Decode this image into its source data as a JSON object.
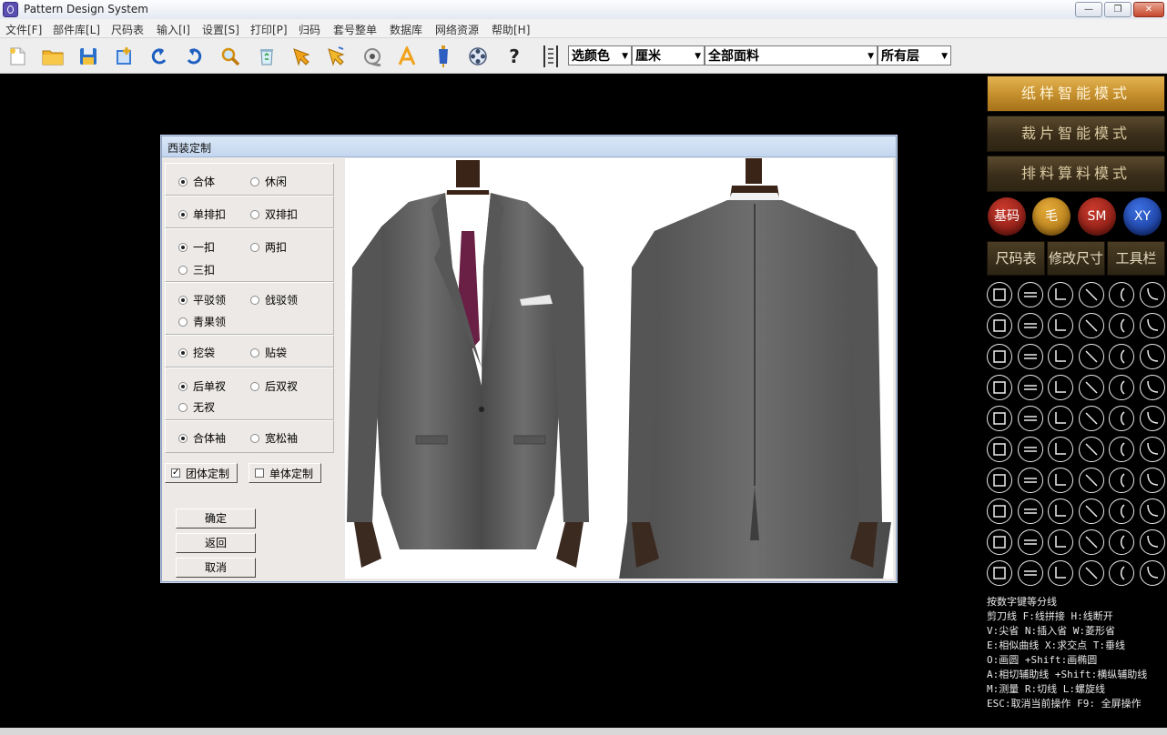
{
  "window": {
    "title": "Pattern Design System",
    "min": "—",
    "max": "❐",
    "close": "✕"
  },
  "menu": [
    "文件[F]",
    "部件库[L]",
    "尺码表",
    "输入[I]",
    "设置[S]",
    "打印[P]",
    "归码",
    "套号整单",
    "数据库",
    "网络资源",
    "帮助[H]"
  ],
  "toolbar": {
    "icons": [
      "new-file-icon",
      "open-folder-icon",
      "save-icon",
      "add-page-icon",
      "undo-icon",
      "redo-icon",
      "zoom-icon",
      "recycle-bin-icon",
      "pointer-arrow-icon",
      "select-arrow-icon",
      "tape-icon",
      "text-a-icon",
      "mannequin-icon",
      "film-reel-icon",
      "help-icon",
      "ruler-icon"
    ],
    "help_label": "?",
    "color_select": "选颜色",
    "unit_select": "厘米",
    "fabric_select": "全部面料",
    "layer_select": "所有层"
  },
  "dialog": {
    "title": "西装定制",
    "groups": [
      {
        "options": [
          {
            "label": "合体",
            "checked": true
          },
          {
            "label": "休闲",
            "checked": false
          }
        ]
      },
      {
        "options": [
          {
            "label": "单排扣",
            "checked": true
          },
          {
            "label": "双排扣",
            "checked": false
          }
        ]
      },
      {
        "options": [
          {
            "label": "一扣",
            "checked": true
          },
          {
            "label": "两扣",
            "checked": false
          },
          {
            "label": "三扣",
            "checked": false
          }
        ]
      },
      {
        "options": [
          {
            "label": "平驳领",
            "checked": true
          },
          {
            "label": "戗驳领",
            "checked": false
          },
          {
            "label": "青果领",
            "checked": false
          }
        ]
      },
      {
        "options": [
          {
            "label": "挖袋",
            "checked": true
          },
          {
            "label": "贴袋",
            "checked": false
          }
        ]
      },
      {
        "options": [
          {
            "label": "后单衩",
            "checked": true
          },
          {
            "label": "后双衩",
            "checked": false
          },
          {
            "label": "无衩",
            "checked": false
          }
        ]
      },
      {
        "options": [
          {
            "label": "合体袖",
            "checked": true
          },
          {
            "label": "宽松袖",
            "checked": false
          }
        ]
      }
    ],
    "group_custom": {
      "label": "团体定制",
      "checked": true
    },
    "single_custom": {
      "label": "单体定制",
      "checked": false
    },
    "ok": "确定",
    "back": "返回",
    "cancel": "取消"
  },
  "right_panel": {
    "modes": [
      "纸样智能模式",
      "裁片智能模式",
      "排料算料模式"
    ],
    "circles": [
      {
        "label": "基码",
        "color": "#8b1c14"
      },
      {
        "label": "毛",
        "color": "#c38a1d"
      },
      {
        "label": "SM",
        "color": "#8b1c14"
      },
      {
        "label": "XY",
        "color": "#1a3fa6"
      }
    ],
    "size_buttons": [
      "尺码表",
      "修改尺寸",
      "工具栏"
    ],
    "hints": [
      "按数字键等分线",
      "剪刀线  F:线拼接  H:线断开",
      "V:尖省  N:插入省  W:菱形省",
      "E:相似曲线  X:求交点  T:垂线",
      "O:画圆 +Shift:画椭圆",
      "A:相切辅助线 +Shift:横纵辅助线",
      "M:测量  R:切线  L:螺旋线",
      "ESC:取消当前操作  F9: 全屏操作"
    ]
  }
}
